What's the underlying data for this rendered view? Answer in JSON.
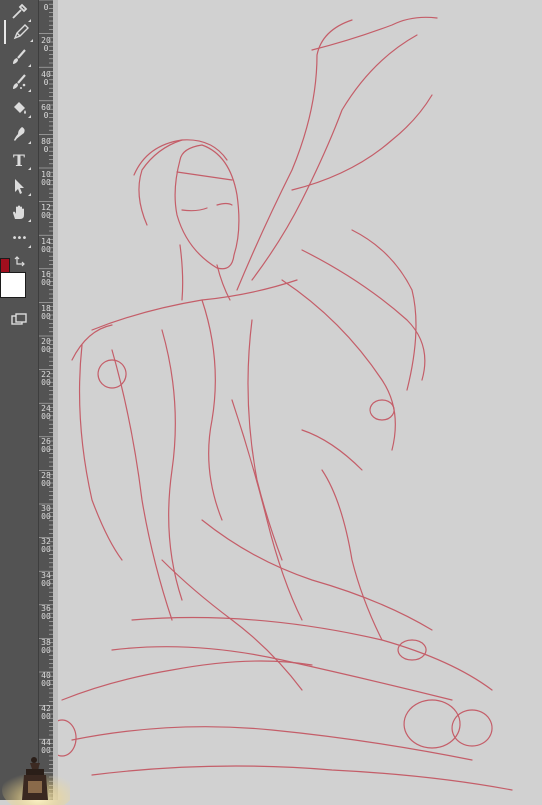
{
  "toolbar": {
    "tools": [
      {
        "name": "eyedropper-icon",
        "has_flyout": true,
        "active": false
      },
      {
        "name": "pencil-icon",
        "has_flyout": true,
        "active": true
      },
      {
        "name": "brush-icon",
        "has_flyout": true,
        "active": false
      },
      {
        "name": "mixer-brush-icon",
        "has_flyout": true,
        "active": false
      },
      {
        "name": "paint-bucket-icon",
        "has_flyout": true,
        "active": false
      },
      {
        "name": "smudge-icon",
        "has_flyout": true,
        "active": false
      },
      {
        "name": "type-tool-icon",
        "label": "T",
        "has_flyout": true,
        "active": false
      },
      {
        "name": "path-selection-icon",
        "has_flyout": true,
        "active": false
      },
      {
        "name": "hand-tool-icon",
        "has_flyout": true,
        "active": false
      },
      {
        "name": "more-tools-icon",
        "label": "•••",
        "has_flyout": true,
        "active": false
      }
    ],
    "foreground_color": "#a00f1e",
    "background_color": "#ffffff",
    "screen_mode_icon": "screen-mode-icon"
  },
  "ruler": {
    "labels": [
      "0",
      "200",
      "400",
      "600",
      "800",
      "1000",
      "1200",
      "1400",
      "1600",
      "1800",
      "2000",
      "2200",
      "2400",
      "2600",
      "2800",
      "3000",
      "3200",
      "3400",
      "3600",
      "3800",
      "4000",
      "4200",
      "4400"
    ]
  },
  "canvas": {
    "background": "#d1d1d1",
    "sketch_color": "#c24a57"
  }
}
